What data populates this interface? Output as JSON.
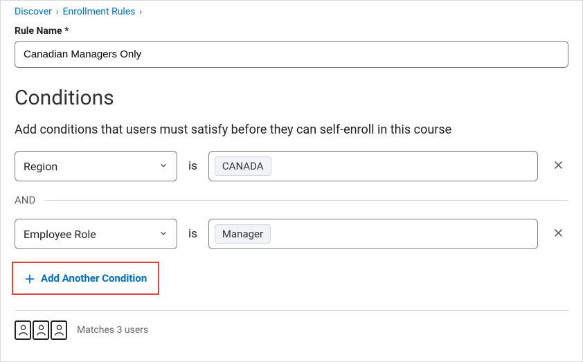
{
  "breadcrumb": {
    "discover": "Discover",
    "enrollment_rules": "Enrollment Rules"
  },
  "rule_name_label": "Rule Name *",
  "rule_name_value": "Canadian Managers Only",
  "conditions_heading": "Conditions",
  "conditions_desc": "Add conditions that users must satisfy before they can self-enroll in this course",
  "is_label": "is",
  "and_label": "AND",
  "conditions": [
    {
      "field": "Region",
      "value": "CANADA"
    },
    {
      "field": "Employee Role",
      "value": "Manager"
    }
  ],
  "add_condition_label": "Add Another Condition",
  "matches_text": "Matches 3 users"
}
